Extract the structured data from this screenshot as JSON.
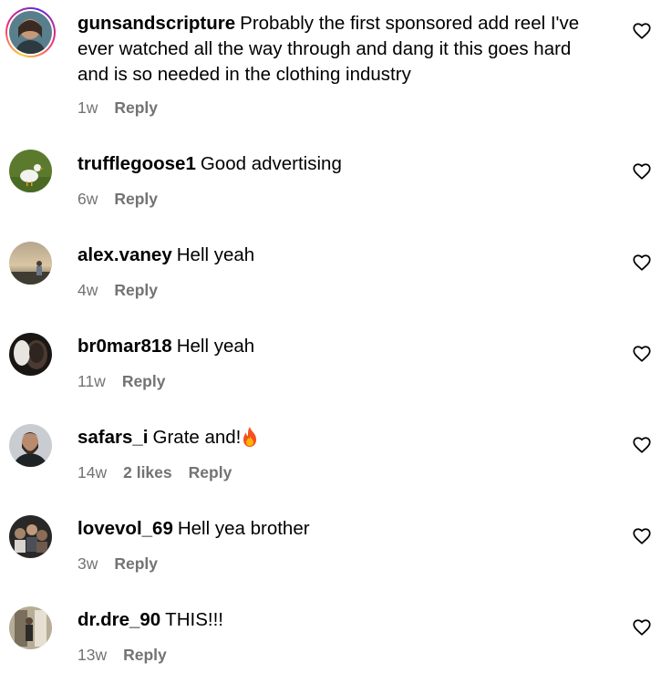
{
  "comments": [
    {
      "username": "gunsandscripture",
      "text": "Probably the first sponsored add reel I've ever watched all the way through and dang it this goes hard and is so needed in the clothing industry",
      "time": "1w",
      "likes": "",
      "reply": "Reply",
      "has_story_ring": true
    },
    {
      "username": "trufflegoose1",
      "text": "Good advertising",
      "time": "6w",
      "likes": "",
      "reply": "Reply"
    },
    {
      "username": "alex.vaney",
      "text": "Hell yeah",
      "time": "4w",
      "likes": "",
      "reply": "Reply"
    },
    {
      "username": "br0mar818",
      "text": "Hell yeah",
      "time": "11w",
      "likes": "",
      "reply": "Reply"
    },
    {
      "username": "safars_i",
      "text": "Grate and!",
      "emoji": "fire-emoji",
      "time": "14w",
      "likes": "2 likes",
      "reply": "Reply"
    },
    {
      "username": "lovevol_69",
      "text": "Hell yea brother",
      "time": "3w",
      "likes": "",
      "reply": "Reply"
    },
    {
      "username": "dr.dre_90",
      "text": "THIS!!!",
      "time": "13w",
      "likes": "",
      "reply": "Reply"
    }
  ],
  "icons": {
    "like": "heart-outline-icon"
  },
  "colors": {
    "secondary_text": "#737373",
    "primary_text": "#000000"
  }
}
